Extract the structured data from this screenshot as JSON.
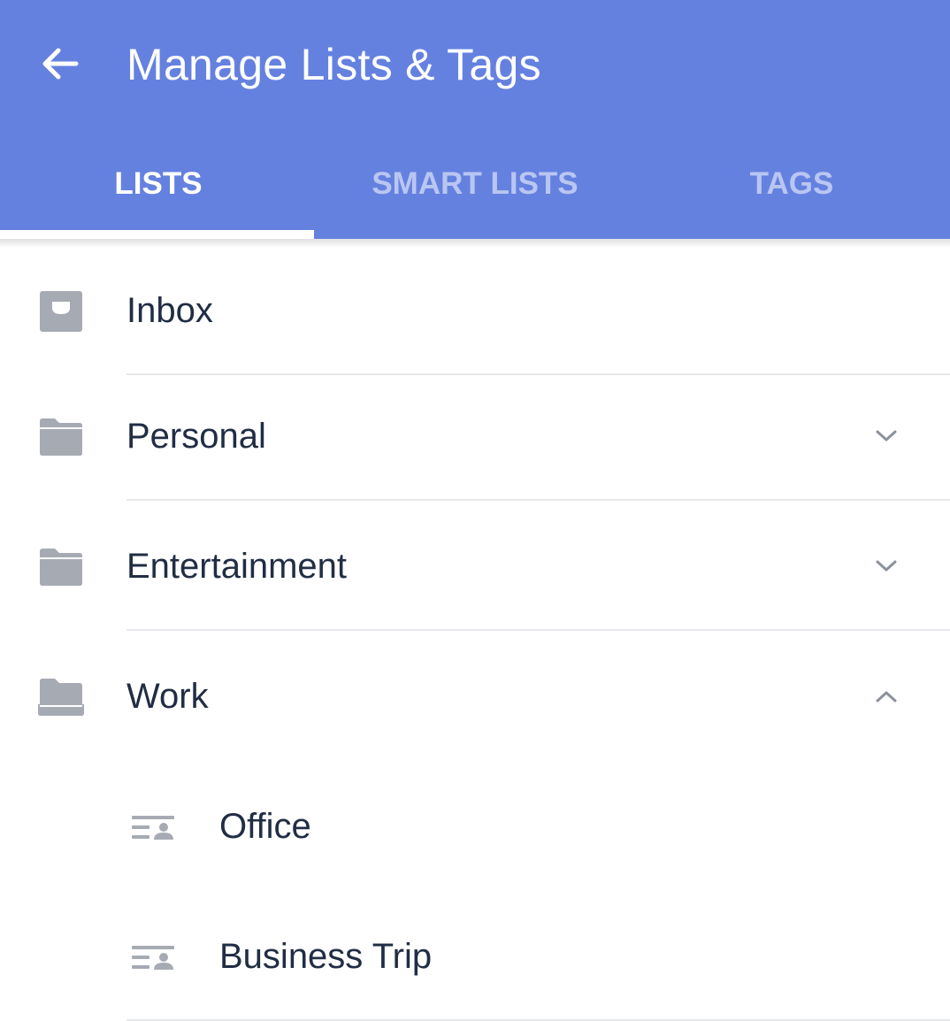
{
  "app_bar": {
    "back_icon": "arrow-left-icon",
    "title": "Manage Lists & Tags",
    "background": "#6581e0"
  },
  "tabs": [
    {
      "label": "LISTS",
      "active": true
    },
    {
      "label": "SMART LISTS",
      "active": false
    },
    {
      "label": "TAGS",
      "active": false
    }
  ],
  "lists": [
    {
      "label": "Inbox",
      "icon": "inbox-icon"
    },
    {
      "label": "Personal",
      "icon": "folder-icon",
      "chevron": "chevron-down-icon"
    },
    {
      "label": "Entertainment",
      "icon": "folder-icon",
      "chevron": "chevron-down-icon"
    },
    {
      "label": "Work",
      "icon": "folder-open-icon",
      "chevron": "chevron-up-icon",
      "expanded": true,
      "children": [
        {
          "label": "Office",
          "icon": "shared-list-icon"
        },
        {
          "label": "Business Trip",
          "icon": "shared-list-icon"
        }
      ]
    }
  ],
  "colors": {
    "text_primary": "#212d44",
    "icon_gray": "#a6abb3",
    "divider": "#e6e8eb"
  }
}
